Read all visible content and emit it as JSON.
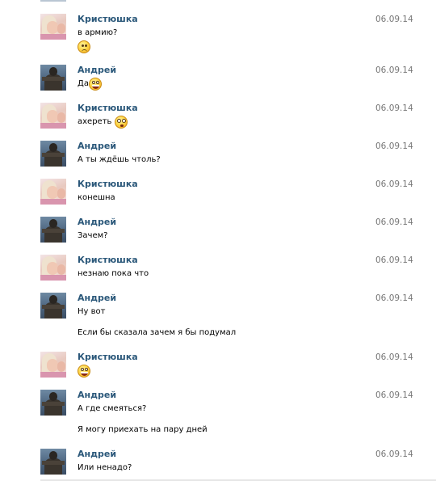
{
  "messages": [
    {
      "author": "Кристюшка",
      "date": "06.09.14",
      "lines": [
        {
          "text": "в армию?"
        },
        {
          "text": "",
          "emoji": "sad"
        }
      ]
    },
    {
      "author": "Андрей",
      "date": "06.09.14",
      "lines": [
        {
          "text": "Да",
          "emoji": "grin"
        }
      ]
    },
    {
      "author": "Кристюшка",
      "date": "06.09.14",
      "lines": [
        {
          "text": "ахереть",
          "emoji": "shocked"
        }
      ]
    },
    {
      "author": "Андрей",
      "date": "06.09.14",
      "lines": [
        {
          "text": "А ты ждёшь чтоль?"
        }
      ]
    },
    {
      "author": "Кристюшка",
      "date": "06.09.14",
      "lines": [
        {
          "text": "конешна"
        }
      ]
    },
    {
      "author": "Андрей",
      "date": "06.09.14",
      "lines": [
        {
          "text": "Зачем?"
        }
      ]
    },
    {
      "author": "Кристюшка",
      "date": "06.09.14",
      "lines": [
        {
          "text": "незнаю пока что"
        }
      ]
    },
    {
      "author": "Андрей",
      "date": "06.09.14",
      "lines": [
        {
          "text": "Ну вот"
        },
        {
          "text": "Если бы сказала зачем я бы подумал"
        }
      ]
    },
    {
      "author": "Кристюшка",
      "date": "06.09.14",
      "lines": [
        {
          "text": "",
          "emoji": "grin"
        }
      ]
    },
    {
      "author": "Андрей",
      "date": "06.09.14",
      "lines": [
        {
          "text": "А где смеяться?"
        },
        {
          "text": "Я могу приехать на пару дней"
        }
      ]
    },
    {
      "author": "Андрей",
      "date": "06.09.14",
      "lines": [
        {
          "text": "Или ненадо?"
        }
      ]
    }
  ]
}
